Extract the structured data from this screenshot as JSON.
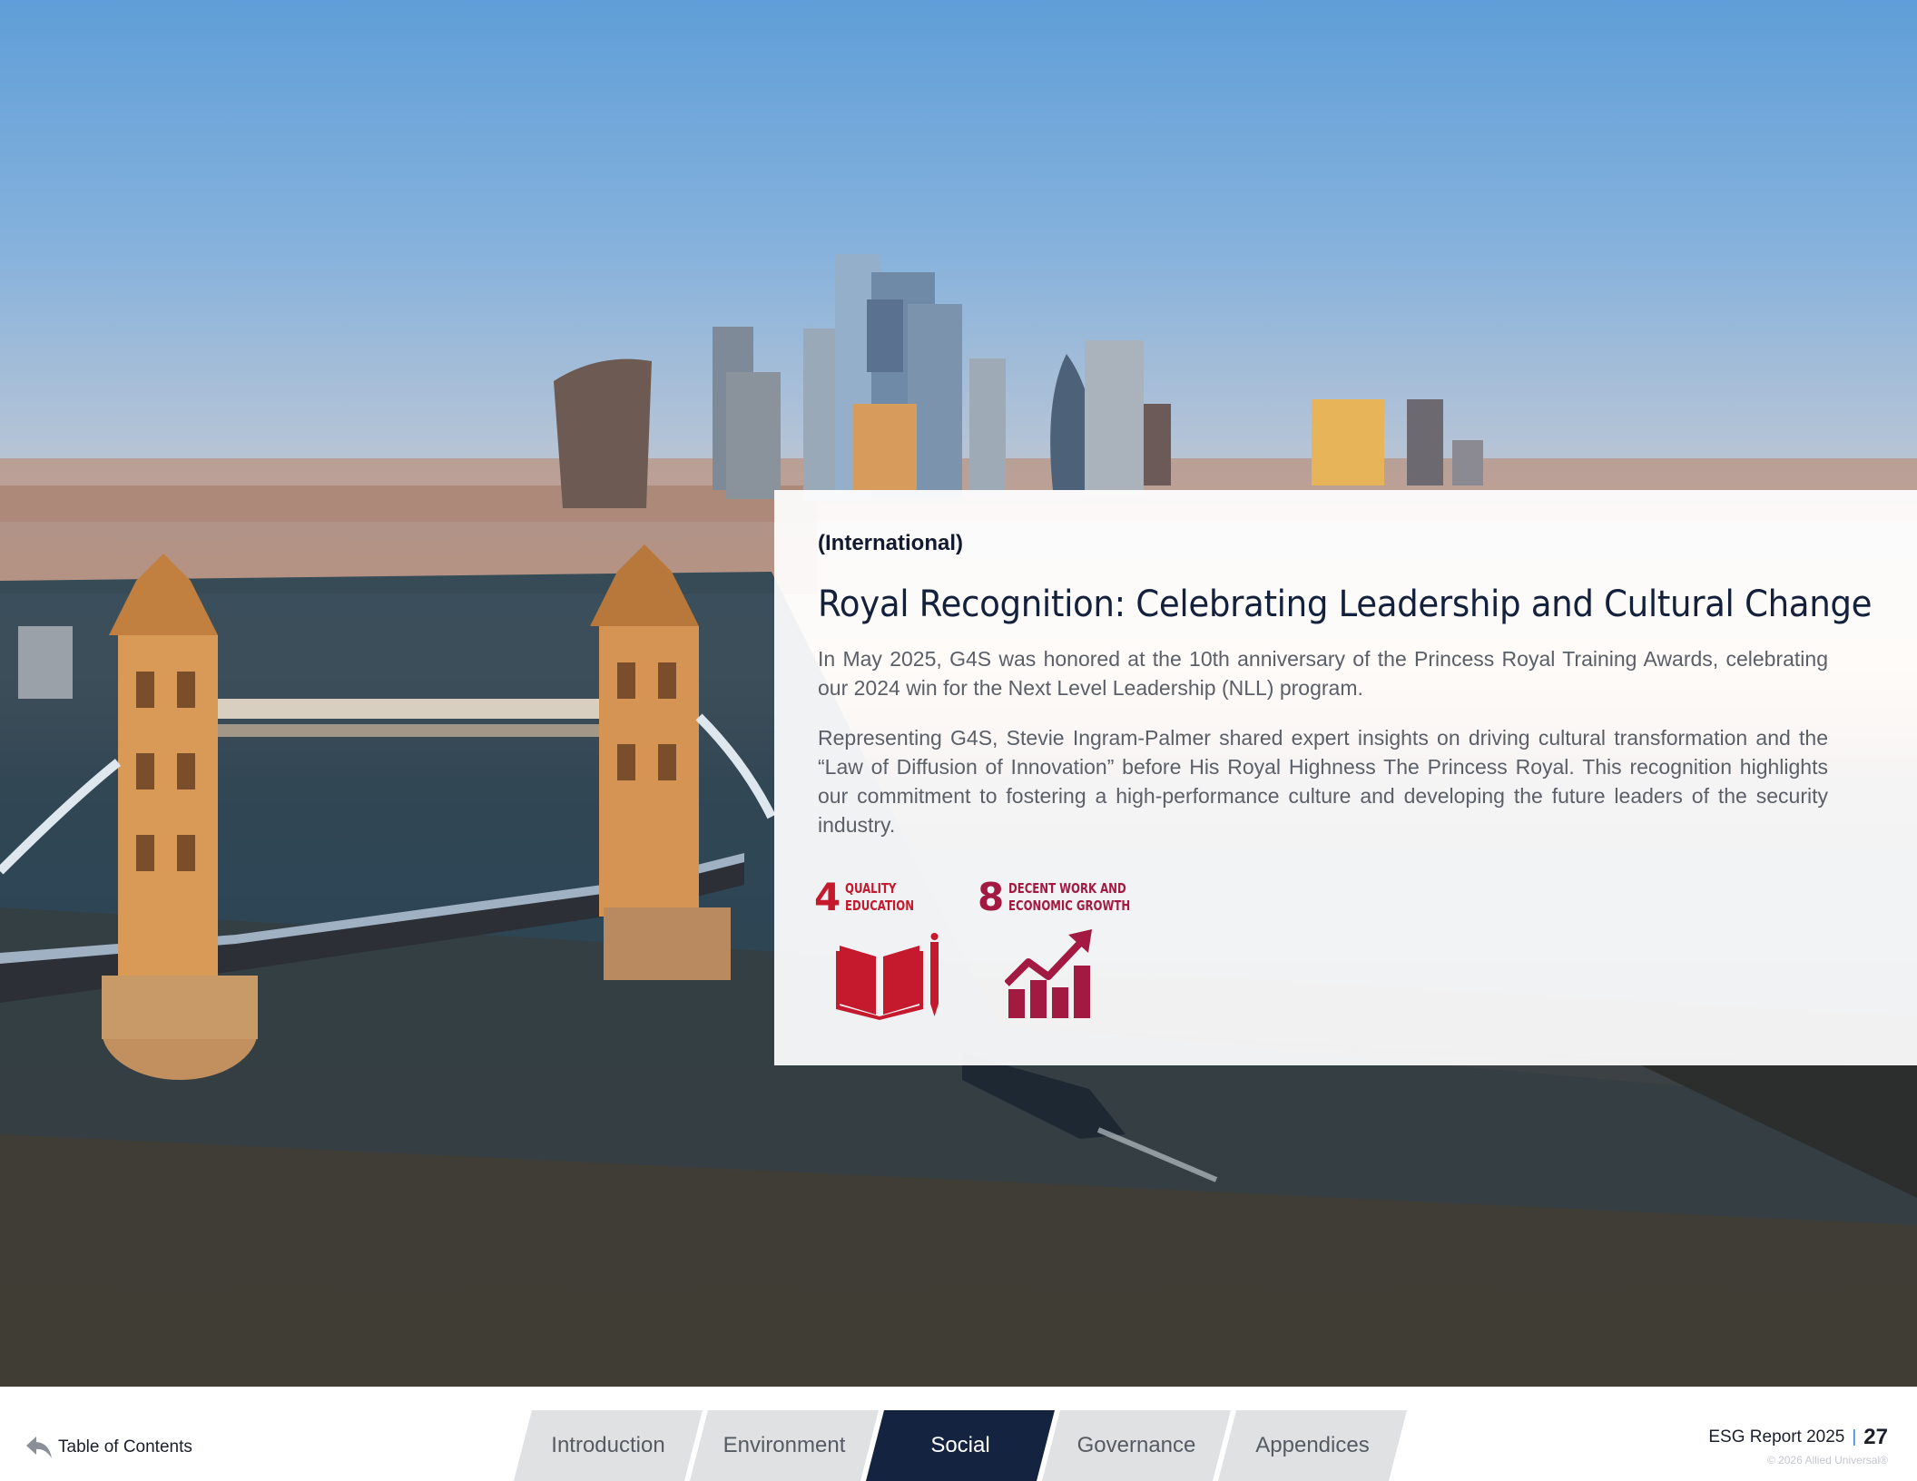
{
  "panel": {
    "region": "(International)",
    "title": "Royal Recognition: Celebrating Leadership and Cultural Change",
    "paragraphs": [
      "In May 2025, G4S was honored at the 10th anniversary of the Princess Royal Training Awards, celebrating our 2024 win for the Next Level Leadership (NLL) program.",
      "Representing G4S, Stevie Ingram-Palmer shared expert insights on driving cultural transformation and the “Law of Diffusion of Innovation” before His Royal Highness The Princess Royal. This recognition highlights our commitment to fostering a high-performance culture and developing the future leaders of the security industry."
    ],
    "sdgs": [
      {
        "number": "4",
        "line1": "Quality",
        "line2": "Education",
        "icon": "book-pencil-icon",
        "color": "#c5192d"
      },
      {
        "number": "8",
        "line1": "Decent Work and",
        "line2": "Economic Growth",
        "icon": "growth-chart-icon",
        "color": "#a21942"
      }
    ]
  },
  "footer": {
    "toc_label": "Table of Contents",
    "tabs": [
      {
        "label": "Introduction",
        "active": false
      },
      {
        "label": "Environment",
        "active": false
      },
      {
        "label": "Social",
        "active": true
      },
      {
        "label": "Governance",
        "active": false
      },
      {
        "label": "Appendices",
        "active": false
      }
    ],
    "report_title": "ESG Report 2025",
    "separator": "|",
    "page_number": "27",
    "copyright": "© 2026 Allied Universal®"
  },
  "colors": {
    "navy": "#142440",
    "sdg_red": "#c5192d",
    "tab_gray": "#e0e1e3",
    "accent_blue": "#3b82c4"
  }
}
